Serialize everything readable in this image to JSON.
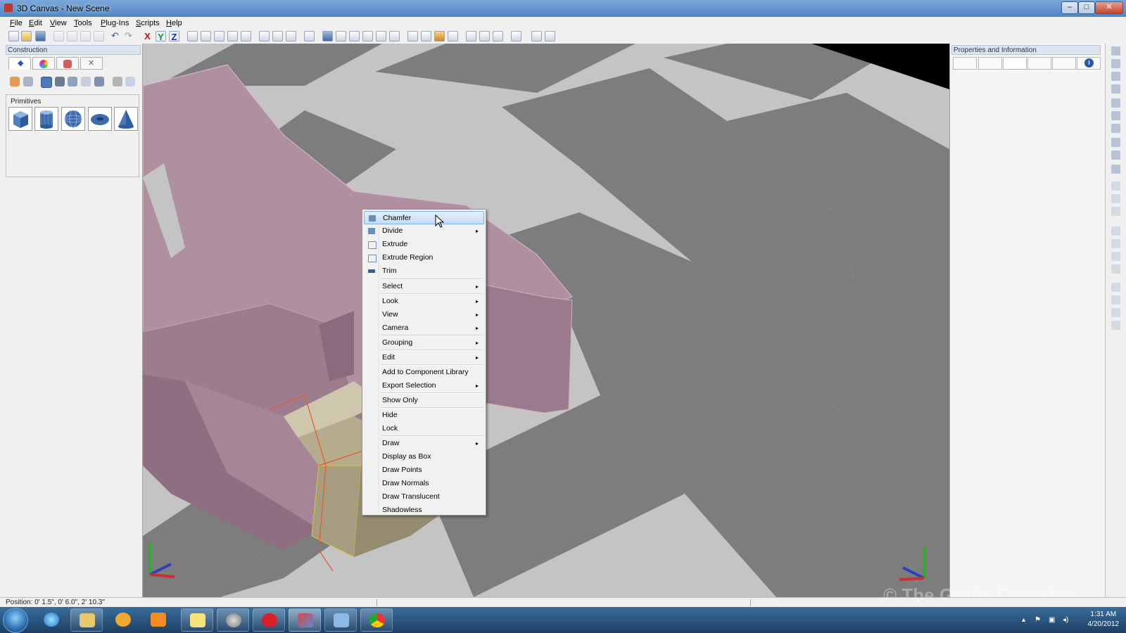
{
  "window": {
    "title": "3D Canvas - New Scene",
    "min": "–",
    "max": "□",
    "close": "✕"
  },
  "menubar": [
    "File",
    "Edit",
    "View",
    "Tools",
    "Plug-Ins",
    "Scripts",
    "Help"
  ],
  "toolbar": {
    "axis_x": "X",
    "axis_y": "Y",
    "axis_z": "Z"
  },
  "left_panel": {
    "title": "Construction",
    "primitives_label": "Primitives",
    "primitives": [
      "cube-icon",
      "cylinder-icon",
      "sphere-icon",
      "torus-icon",
      "cone-icon"
    ]
  },
  "right_panel": {
    "title": "Properties and Information"
  },
  "context_menu": {
    "items": [
      {
        "label": "Chamfer",
        "icon": "chamfer-icon",
        "highlighted": true
      },
      {
        "label": "Divide",
        "icon": "divide-icon",
        "submenu": true
      },
      {
        "label": "Extrude",
        "icon": "extrude-icon"
      },
      {
        "label": "Extrude Region",
        "icon": "extrude-region-icon"
      },
      {
        "label": "Trim",
        "icon": "trim-icon"
      },
      {
        "label": "Select",
        "submenu": true
      },
      {
        "label": "Look",
        "submenu": true
      },
      {
        "label": "View",
        "submenu": true
      },
      {
        "label": "Camera",
        "submenu": true
      },
      {
        "label": "Grouping",
        "submenu": true
      },
      {
        "label": "Edit",
        "submenu": true
      },
      {
        "label": "Add to Component Library"
      },
      {
        "label": "Export Selection",
        "submenu": true
      },
      {
        "label": "Show Only"
      },
      {
        "label": "Hide"
      },
      {
        "label": "Lock"
      },
      {
        "label": "Draw",
        "submenu": true
      },
      {
        "label": "Display as Box"
      },
      {
        "label": "Draw Points"
      },
      {
        "label": "Draw Normals"
      },
      {
        "label": "Draw Translucent"
      },
      {
        "label": "Shadowless"
      }
    ],
    "arrow": "▸"
  },
  "status": {
    "position": "Position: 0' 1.5\", 0' 6.0\", 2' 10.3\""
  },
  "watermark": "© The Grade Crossing",
  "taskbar": {
    "apps": [
      "internet-explorer-icon",
      "file-explorer-icon",
      "media-app-icon",
      "media-player-icon",
      "sticky-notes-icon",
      "web-globe-icon",
      "red-app-icon",
      "3d-canvas-icon",
      "window-app-icon",
      "chrome-icon"
    ],
    "time": "1:31 AM",
    "date": "4/20/2012"
  },
  "colors": {
    "selection_highlight": "#c4ddf6",
    "model_pink": "#b08fa0",
    "checker_dark": "#7d7d7d",
    "checker_light": "#c4c4c4"
  }
}
